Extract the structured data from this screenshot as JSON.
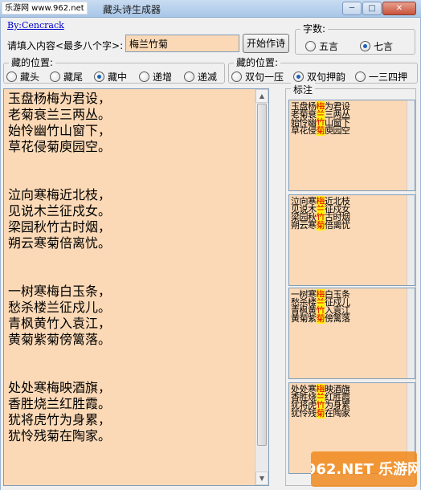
{
  "window": {
    "title": "藏头诗生成器",
    "watermark_site": "乐游网 www.962.net",
    "minimize_icon": "minimize-icon",
    "maximize_icon": "maximize-icon",
    "close_icon": "close-icon"
  },
  "author_link": "By:Cencrack",
  "input": {
    "label": "请填入内容<最多八个字>:",
    "value": "梅兰竹菊"
  },
  "start_button": "开始作诗",
  "char_count": {
    "legend": "字数:",
    "options": [
      "五言",
      "七言"
    ],
    "selected": "七言"
  },
  "hide_position": {
    "legend": "藏的位置:",
    "options": [
      "藏头",
      "藏尾",
      "藏中",
      "递增",
      "递减"
    ],
    "selected": "藏中"
  },
  "rhyme_position": {
    "legend": "藏的位置:",
    "options": [
      "双句一压",
      "双句押韵",
      "一三四押"
    ],
    "selected": "双句押韵"
  },
  "poems_text": "玉盘杨梅为君设，\n老菊衰兰三两丛。\n始怜幽竹山窗下，\n草花侵菊庾园空。\n\n\n泣向寒梅近北枝，\n见说木兰征戍女。\n梁园秋竹古时烟，\n朔云寒菊倍离忧。\n\n\n一树寒梅白玉条，\n愁杀楼兰征戍儿。\n青枫黄竹入袁江，\n黄菊紫菊傍篱落。\n\n\n处处寒梅映酒旗，\n香胜烧兰红胜霞。\n犹将虎竹为身累，\n犹怜残菊在陶家。",
  "notes": {
    "title": "标注",
    "cards": [
      {
        "lines": [
          {
            "pre": "玉盘杨",
            "hl": "梅",
            "post": "为君设"
          },
          {
            "pre": "老菊衰",
            "hl": "兰",
            "post": "三两丛"
          },
          {
            "pre": "始怜幽",
            "hl": "竹",
            "post": "山窗下"
          },
          {
            "pre": "草花侵",
            "hl": "菊",
            "post": "庾园空"
          }
        ]
      },
      {
        "lines": [
          {
            "pre": "泣向寒",
            "hl": "梅",
            "post": "近北枝"
          },
          {
            "pre": "见说木",
            "hl": "兰",
            "post": "征戍女"
          },
          {
            "pre": "梁园秋",
            "hl": "竹",
            "post": "古时烟"
          },
          {
            "pre": "朔云寒",
            "hl": "菊",
            "post": "倍离忧"
          }
        ]
      },
      {
        "lines": [
          {
            "pre": "一树寒",
            "hl": "梅",
            "post": "白玉条"
          },
          {
            "pre": "愁杀楼",
            "hl": "兰",
            "post": "征戍儿"
          },
          {
            "pre": "青枫黄",
            "hl": "竹",
            "post": "入袁江"
          },
          {
            "pre": "黄菊紫",
            "hl": "菊",
            "post": "傍篱落"
          }
        ]
      },
      {
        "lines": [
          {
            "pre": "处处寒",
            "hl": "梅",
            "post": "映酒旗"
          },
          {
            "pre": "香胜烧",
            "hl": "兰",
            "post": "红胜霞"
          },
          {
            "pre": "犹将虎",
            "hl": "竹",
            "post": "为身累"
          },
          {
            "pre": "犹怜残",
            "hl": "菊",
            "post": "在陶家"
          }
        ]
      }
    ]
  },
  "watermark_logo": "962.NET 乐游网",
  "colors": {
    "text_bg": "#fcd9b6",
    "highlight": "#e00000",
    "highlight_bg": "#fff200",
    "link": "#0000cc",
    "logo_orange": "#f08a1e"
  }
}
